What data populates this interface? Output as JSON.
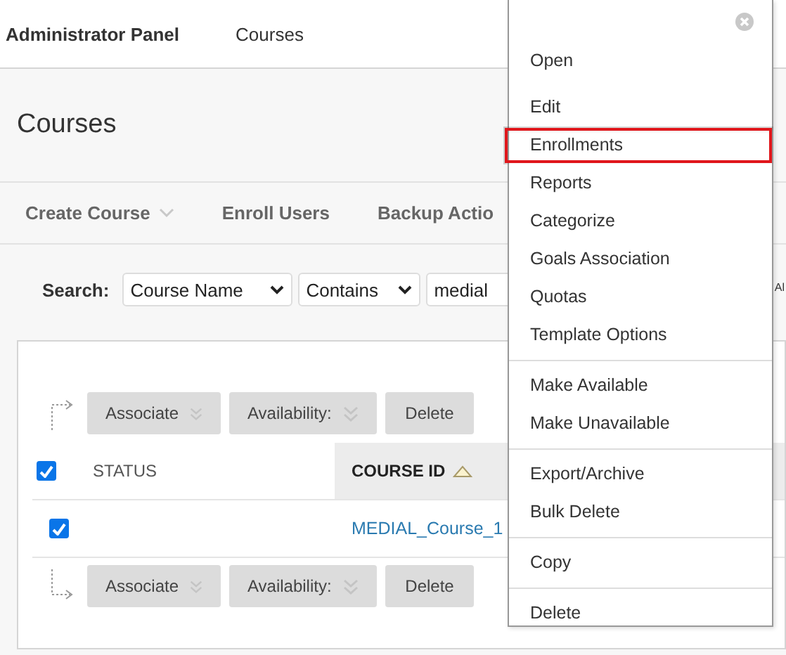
{
  "top_bar": {
    "title": "Administrator Panel",
    "breadcrumb": "Courses"
  },
  "page_title": "Courses",
  "action_bar": [
    {
      "label": "Create Course",
      "kind": "dropdown"
    },
    {
      "label": "Enroll Users",
      "kind": "plain"
    },
    {
      "label": "Backup Actio",
      "kind": "plain"
    }
  ],
  "search": {
    "label": "Search:",
    "field": "Course Name",
    "operator": "Contains",
    "value": "medial",
    "trailing": "Al"
  },
  "table": {
    "top_actions": [
      {
        "label": "Associate",
        "kind": "dropdown"
      },
      {
        "label": "Availability:",
        "kind": "dropdown"
      },
      {
        "label": "Delete",
        "kind": "plain"
      }
    ],
    "select_all_checked": true,
    "columns": [
      {
        "label": "STATUS",
        "sorted": false
      },
      {
        "label": "COURSE ID",
        "sorted": true
      }
    ],
    "rows": [
      {
        "checked": true,
        "status": "",
        "course_id": "MEDIAL_Course_1"
      }
    ],
    "bottom_actions": [
      {
        "label": "Associate",
        "kind": "dropdown"
      },
      {
        "label": "Availability:",
        "kind": "dropdown"
      },
      {
        "label": "Delete",
        "kind": "plain"
      }
    ]
  },
  "context_menu": {
    "groups": [
      [
        {
          "label": "Open",
          "highlighted": false
        },
        {
          "label": "Edit",
          "highlighted": false
        },
        {
          "label": "Enrollments",
          "highlighted": true
        },
        {
          "label": "Reports",
          "highlighted": false
        },
        {
          "label": "Categorize",
          "highlighted": false
        },
        {
          "label": "Goals Association",
          "highlighted": false
        },
        {
          "label": "Quotas",
          "highlighted": false
        },
        {
          "label": "Template Options",
          "highlighted": false
        }
      ],
      [
        {
          "label": "Make Available",
          "highlighted": false
        },
        {
          "label": "Make Unavailable",
          "highlighted": false
        }
      ],
      [
        {
          "label": "Export/Archive",
          "highlighted": false
        },
        {
          "label": "Bulk Delete",
          "highlighted": false
        }
      ],
      [
        {
          "label": "Copy",
          "highlighted": false
        }
      ],
      [
        {
          "label": "Delete",
          "highlighted": false
        }
      ]
    ]
  }
}
